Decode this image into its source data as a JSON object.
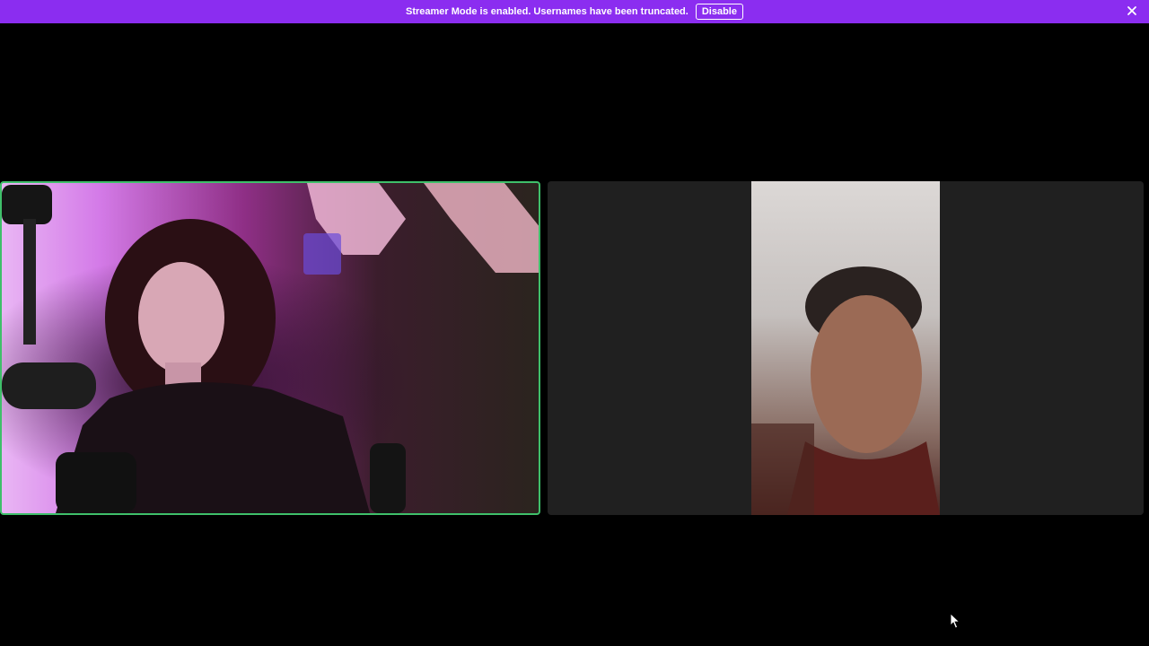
{
  "banner": {
    "message": "Streamer Mode is enabled. Usernames have been truncated.",
    "disable_label": "Disable",
    "close_icon": "close-icon",
    "background_color": "#8b2df0"
  },
  "call": {
    "participants": [
      {
        "role": "local-speaker",
        "active_speaker": true,
        "border_color": "#3fbf6a"
      },
      {
        "role": "remote-participant",
        "active_speaker": false
      }
    ],
    "cursor_icon": "mouse-pointer-icon"
  }
}
